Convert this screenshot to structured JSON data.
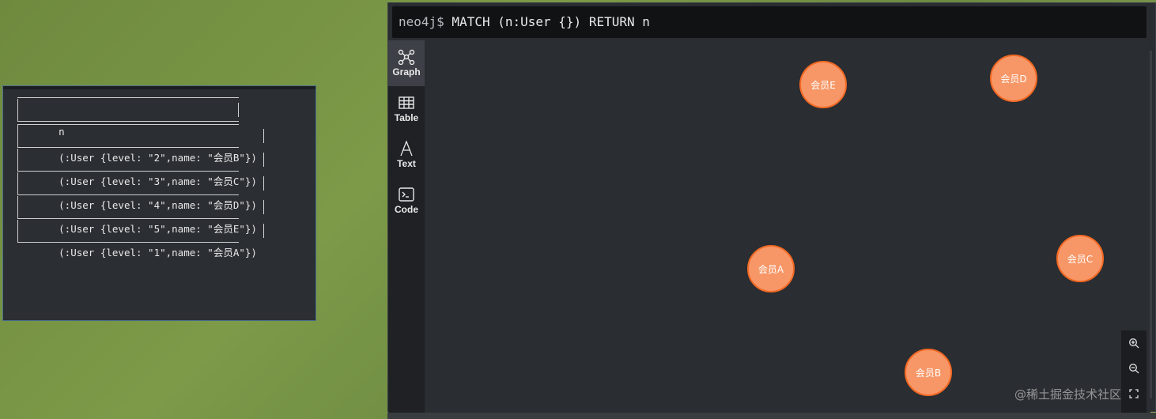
{
  "terminal": {
    "header": "n",
    "rows": [
      "(:User {level: \"2\",name: \"会员B\"})",
      "(:User {level: \"3\",name: \"会员C\"})",
      "(:User {level: \"4\",name: \"会员D\"})",
      "(:User {level: \"5\",name: \"会员E\"})",
      "(:User {level: \"1\",name: \"会员A\"})"
    ]
  },
  "neo4j": {
    "prompt": "neo4j$",
    "query": " MATCH (n:User {}) RETURN n",
    "sidebar": [
      {
        "label": "Graph",
        "icon": "graph-icon"
      },
      {
        "label": "Table",
        "icon": "table-icon"
      },
      {
        "label": "Text",
        "icon": "text-icon"
      },
      {
        "label": "Code",
        "icon": "code-icon"
      }
    ],
    "active_view": "Graph",
    "nodes": [
      {
        "label": "会员E"
      },
      {
        "label": "会员D"
      },
      {
        "label": "会员A"
      },
      {
        "label": "会员C"
      },
      {
        "label": "会员B"
      }
    ],
    "node_color": "#f79767",
    "node_border_color": "#f36924",
    "zoom_controls": [
      "zoom-in-icon",
      "zoom-out-icon",
      "fit-icon"
    ]
  },
  "watermark": "@稀土掘金技术社区"
}
